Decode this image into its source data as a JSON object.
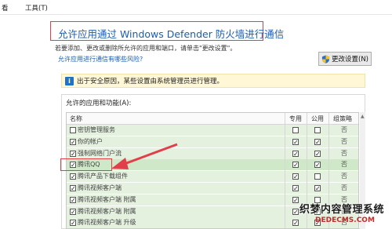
{
  "menu": {
    "items": [
      "看",
      "工具(T)"
    ]
  },
  "header": {
    "title": "允许应用通过 Windows Defender 防火墙进行通信",
    "subtitle": "若要添加、更改或删除所允许的应用和端口，请单击\"更改设置\"。",
    "risk_link": "允许应用进行通信有哪些风险?",
    "change_button": "更改设置(N)"
  },
  "notice": {
    "text": "出于安全原因，某些设置由系统管理员进行管理。"
  },
  "apps": {
    "group_label": "允许的应用和功能(A):",
    "columns": {
      "name": "名称",
      "private": "专用",
      "public": "公用",
      "policy": "组策略"
    },
    "rows": [
      {
        "name": "密钥管理服务",
        "checked": false,
        "private": false,
        "public": false,
        "policy": "否"
      },
      {
        "name": "你的帐户",
        "checked": true,
        "private": true,
        "public": true,
        "policy": "否"
      },
      {
        "name": "强制网络门户流",
        "checked": true,
        "private": true,
        "public": true,
        "policy": "否"
      },
      {
        "name": "腾讯QQ",
        "checked": true,
        "private": true,
        "public": true,
        "policy": "否"
      },
      {
        "name": "腾讯产品下载组件",
        "checked": true,
        "private": true,
        "public": false,
        "policy": "否"
      },
      {
        "name": "腾讯视频客户端",
        "checked": true,
        "private": true,
        "public": true,
        "policy": "否"
      },
      {
        "name": "腾讯视频客户端 附属",
        "checked": true,
        "private": true,
        "public": false,
        "policy": "否"
      },
      {
        "name": "腾讯视频客户端 附属",
        "checked": true,
        "private": true,
        "public": true,
        "policy": "否"
      },
      {
        "name": "腾讯视频客户端 升级",
        "checked": true,
        "private": true,
        "public": true,
        "policy": "否"
      }
    ]
  },
  "watermark": {
    "line1": "织梦内容管理系统",
    "line2": "DEDECMS.COM"
  },
  "colors": {
    "title_blue": "#1b5db0",
    "highlight_red": "#e1404a",
    "row_green": "#e4f1df"
  }
}
